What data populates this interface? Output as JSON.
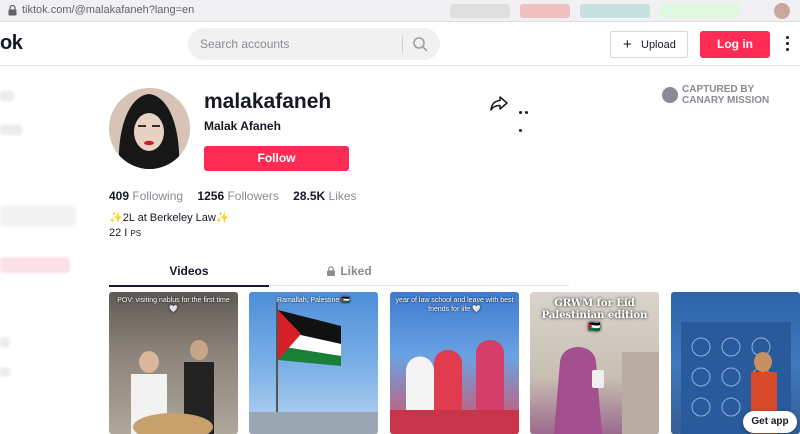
{
  "browser": {
    "url": "tiktok.com/@malakafaneh?lang=en"
  },
  "header": {
    "logo": "ok",
    "search_placeholder": "Search accounts",
    "upload_label": "Upload",
    "login_label": "Log in"
  },
  "profile": {
    "username": "malakafaneh",
    "nickname": "Malak Afaneh",
    "follow_label": "Follow",
    "captured_line1": "CAPTURED BY",
    "captured_line2": "CANARY MISSION",
    "stats": {
      "following_count": "409",
      "following_label": "Following",
      "followers_count": "1256",
      "followers_label": "Followers",
      "likes_count": "28.5K",
      "likes_label": "Likes"
    },
    "bio_line1": "✨2L at Berkeley Law✨",
    "bio_line2_main": "22 I ",
    "bio_line2_small": "PS"
  },
  "tabs": {
    "videos": "Videos",
    "liked": "Liked"
  },
  "videos": [
    {
      "caption": "POV: visiting nablus for the first time 🤍"
    },
    {
      "caption": "Ramallah, Palestine 🇵🇸"
    },
    {
      "caption": "year of law school and leave with best friends for life 🤍"
    },
    {
      "caption": "GRWM for Eid Palestinian edition 🇵🇸"
    },
    {
      "caption": ""
    }
  ],
  "get_app_label": "Get app",
  "colors": {
    "brand": "#fe2c55",
    "text": "#161823",
    "muted": "#8a8b91"
  }
}
